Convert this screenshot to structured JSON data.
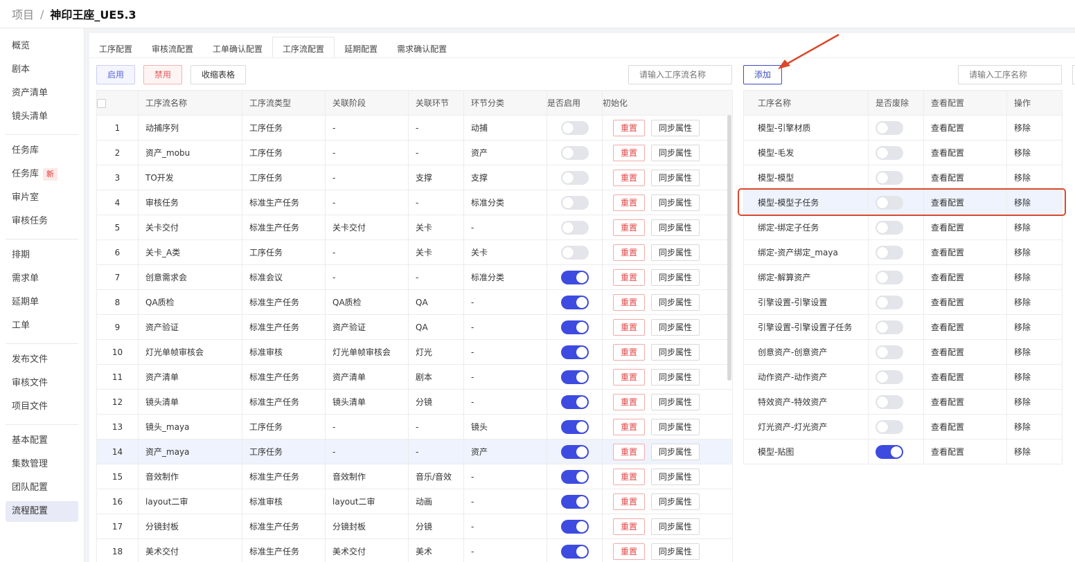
{
  "breadcrumb": {
    "root": "项目",
    "separator": "/",
    "current": "神印王座_UE5.3"
  },
  "sidebar": {
    "groups": [
      [
        "概览",
        "剧本",
        "资产清单",
        "镜头清单"
      ],
      [
        "任务库",
        "任务库",
        "审片室",
        "审核任务"
      ],
      [
        "排期",
        "需求单",
        "延期单",
        "工单"
      ],
      [
        "发布文件",
        "审核文件",
        "项目文件"
      ],
      [
        "基本配置",
        "集数管理",
        "团队配置",
        "流程配置"
      ]
    ],
    "new_badge": "新"
  },
  "tabs": [
    "工序配置",
    "审核流配置",
    "工单确认配置",
    "工序流配置",
    "延期配置",
    "需求确认配置"
  ],
  "toolbar": {
    "enable": "启用",
    "disable": "禁用",
    "collapse": "收缩表格",
    "add": "添加",
    "search_flow_placeholder": "请输入工序流名称",
    "search_proc_placeholder": "请输入工序名称"
  },
  "left_table": {
    "headers": [
      "工序流名称",
      "工序流类型",
      "关联阶段",
      "关联环节",
      "环节分类",
      "是否启用",
      "初始化"
    ],
    "reset_label": "重置",
    "sync_label": "同步属性",
    "rows": [
      {
        "no": "1",
        "name": "动捕序列",
        "type": "工序任务",
        "stage": "-",
        "link": "-",
        "cat": "动捕",
        "on": false
      },
      {
        "no": "2",
        "name": "资产_mobu",
        "type": "工序任务",
        "stage": "-",
        "link": "-",
        "cat": "资产",
        "on": false
      },
      {
        "no": "3",
        "name": "TO开发",
        "type": "工序任务",
        "stage": "-",
        "link": "支撑",
        "cat": "支撑",
        "on": false
      },
      {
        "no": "4",
        "name": "审核任务",
        "type": "标准生产任务",
        "stage": "-",
        "link": "-",
        "cat": "标准分类",
        "on": false
      },
      {
        "no": "5",
        "name": "关卡交付",
        "type": "标准生产任务",
        "stage": "关卡交付",
        "link": "关卡",
        "cat": "-",
        "on": false
      },
      {
        "no": "6",
        "name": "关卡_A类",
        "type": "工序任务",
        "stage": "-",
        "link": "关卡",
        "cat": "关卡",
        "on": false
      },
      {
        "no": "7",
        "name": "创意需求会",
        "type": "标准会议",
        "stage": "-",
        "link": "-",
        "cat": "标准分类",
        "on": true
      },
      {
        "no": "8",
        "name": "QA质检",
        "type": "标准生产任务",
        "stage": "QA质检",
        "link": "QA",
        "cat": "-",
        "on": true
      },
      {
        "no": "9",
        "name": "资产验证",
        "type": "标准生产任务",
        "stage": "资产验证",
        "link": "QA",
        "cat": "-",
        "on": true
      },
      {
        "no": "10",
        "name": "灯光单帧审核会",
        "type": "标准审核",
        "stage": "灯光单帧审核会",
        "link": "灯光",
        "cat": "-",
        "on": true
      },
      {
        "no": "11",
        "name": "资产清单",
        "type": "标准生产任务",
        "stage": "资产清单",
        "link": "剧本",
        "cat": "-",
        "on": true
      },
      {
        "no": "12",
        "name": "镜头清单",
        "type": "标准生产任务",
        "stage": "镜头清单",
        "link": "分镜",
        "cat": "-",
        "on": true
      },
      {
        "no": "13",
        "name": "镜头_maya",
        "type": "工序任务",
        "stage": "-",
        "link": "-",
        "cat": "镜头",
        "on": true
      },
      {
        "no": "14",
        "name": "资产_maya",
        "type": "工序任务",
        "stage": "-",
        "link": "-",
        "cat": "资产",
        "on": true
      },
      {
        "no": "15",
        "name": "音效制作",
        "type": "标准生产任务",
        "stage": "音效制作",
        "link": "音乐/音效",
        "cat": "-",
        "on": true
      },
      {
        "no": "16",
        "name": "layout二审",
        "type": "标准审核",
        "stage": "layout二审",
        "link": "动画",
        "cat": "-",
        "on": true
      },
      {
        "no": "17",
        "name": "分镜封板",
        "type": "标准生产任务",
        "stage": "分镜封板",
        "link": "分镜",
        "cat": "-",
        "on": true
      },
      {
        "no": "18",
        "name": "美术交付",
        "type": "标准生产任务",
        "stage": "美术交付",
        "link": "美术",
        "cat": "-",
        "on": true
      }
    ]
  },
  "right_table": {
    "headers": [
      "工序名称",
      "是否废除",
      "查看配置",
      "操作"
    ],
    "view_label": "查看配置",
    "remove_label": "移除",
    "rows": [
      {
        "name": "模型-引擎材质",
        "on": false
      },
      {
        "name": "模型-毛发",
        "on": false
      },
      {
        "name": "模型-模型",
        "on": false
      },
      {
        "name": "模型-模型子任务",
        "on": false
      },
      {
        "name": "绑定-绑定子任务",
        "on": false
      },
      {
        "name": "绑定-资产绑定_maya",
        "on": false
      },
      {
        "name": "绑定-解算资产",
        "on": false
      },
      {
        "name": "引擎设置-引擎设置",
        "on": false
      },
      {
        "name": "引擎设置-引擎设置子任务",
        "on": false
      },
      {
        "name": "创意资产-创意资产",
        "on": false
      },
      {
        "name": "动作资产-动作资产",
        "on": false
      },
      {
        "name": "特效资产-特效资产",
        "on": false
      },
      {
        "name": "灯光资产-灯光资产",
        "on": false
      },
      {
        "name": "模型-贴图",
        "on": true
      }
    ]
  },
  "colors": {
    "accent": "#3e4be0",
    "danger": "#e34848",
    "annotation": "#d9482b"
  }
}
